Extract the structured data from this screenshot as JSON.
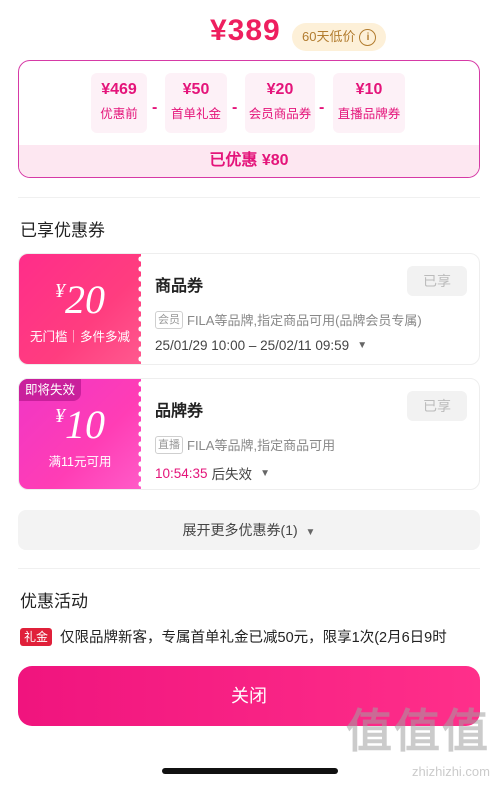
{
  "price": {
    "amount": "¥389",
    "lowest_badge": "60天低价",
    "info_icon": "info-icon"
  },
  "breakdown": {
    "items": [
      {
        "value": "¥469",
        "label": "优惠前"
      },
      {
        "value": "¥50",
        "label": "首单礼金"
      },
      {
        "value": "¥20",
        "label": "会员商品券"
      },
      {
        "value": "¥10",
        "label": "直播品牌券"
      }
    ],
    "operator": "-",
    "total": "已优惠 ¥80"
  },
  "coupons_section": {
    "title": "已享优惠券"
  },
  "coupons": [
    {
      "symbol": "¥",
      "amount": "20",
      "condition": "无门槛｜多件多减",
      "name": "商品券",
      "button": "已享",
      "tag": "会员",
      "desc": "FILA等品牌,指定商品可用(品牌会员专属)",
      "time": "25/01/29 10:00 – 25/02/11 09:59"
    },
    {
      "badge": "即将失效",
      "symbol": "¥",
      "amount": "10",
      "condition": "满11元可用",
      "name": "品牌券",
      "button": "已享",
      "tag": "直播",
      "desc": "FILA等品牌,指定商品可用",
      "countdown": "10:54:35",
      "countdown_suffix": "后失效"
    }
  ],
  "expand": {
    "label": "展开更多优惠券(1)"
  },
  "activities": {
    "title": "优惠活动",
    "items": [
      {
        "tag": "礼金",
        "text": "仅限品牌新客，专属首单礼金已减50元，限享1次(2月6日9时"
      }
    ]
  },
  "close_button": "关闭",
  "watermark": {
    "logo": "值值值",
    "domain": "zhizhizhi.com"
  },
  "colors": {
    "accent": "#e4147a",
    "border": "#d63aa6",
    "expired_tag": "#c9209c"
  }
}
